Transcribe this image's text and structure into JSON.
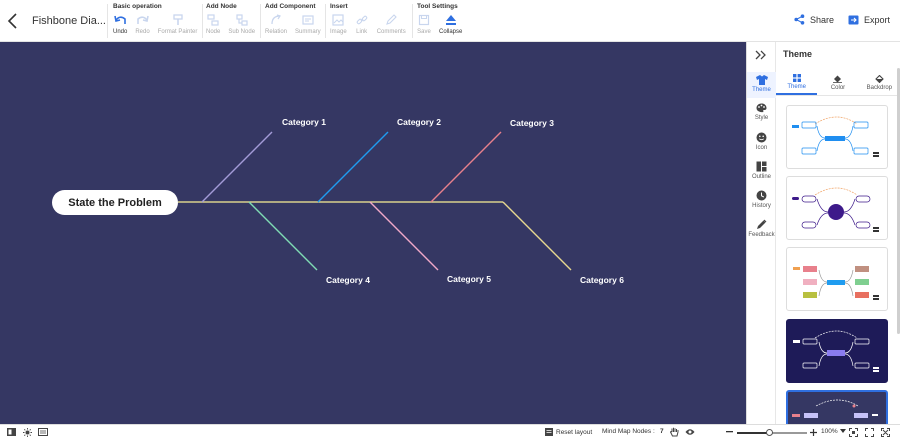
{
  "header": {
    "doc_title": "Fishbone Dia...",
    "groups": [
      {
        "label": "Basic operation",
        "tools": [
          {
            "label": "Undo",
            "icon": "undo-icon",
            "enabled": true
          },
          {
            "label": "Redo",
            "icon": "redo-icon",
            "enabled": false
          },
          {
            "label": "Format Painter",
            "icon": "format-painter-icon",
            "enabled": false
          }
        ]
      },
      {
        "label": "Add Node",
        "tools": [
          {
            "label": "Node",
            "icon": "node-icon",
            "enabled": false
          },
          {
            "label": "Sub Node",
            "icon": "sub-node-icon",
            "enabled": false
          }
        ]
      },
      {
        "label": "Add Component",
        "tools": [
          {
            "label": "Relation",
            "icon": "relation-icon",
            "enabled": false
          },
          {
            "label": "Summary",
            "icon": "summary-icon",
            "enabled": false
          }
        ]
      },
      {
        "label": "Insert",
        "tools": [
          {
            "label": "Image",
            "icon": "image-icon",
            "enabled": false
          },
          {
            "label": "Link",
            "icon": "link-icon",
            "enabled": false
          },
          {
            "label": "Comments",
            "icon": "comments-icon",
            "enabled": false
          }
        ]
      },
      {
        "label": "Tool Settings",
        "tools": [
          {
            "label": "Save",
            "icon": "save-icon",
            "enabled": false
          },
          {
            "label": "Collapse",
            "icon": "collapse-icon",
            "enabled": true
          }
        ]
      }
    ],
    "share_label": "Share",
    "export_label": "Export"
  },
  "canvas": {
    "head": "State the Problem",
    "categories": [
      "Category 1",
      "Category 2",
      "Category 3",
      "Category 4",
      "Category 5",
      "Category 6"
    ],
    "colors": {
      "background": "#353763",
      "spine": "#d9d08c",
      "bones": [
        "#a39bd8",
        "#1f9cf0",
        "#e8808c",
        "#7fdcb4",
        "#f0a8c8",
        "#e8d890"
      ]
    }
  },
  "rail": {
    "items": [
      {
        "label": "Theme",
        "icon": "shirt-icon",
        "active": true
      },
      {
        "label": "Style",
        "icon": "palette-icon",
        "active": false
      },
      {
        "label": "Icon",
        "icon": "smiley-icon",
        "active": false
      },
      {
        "label": "Outline",
        "icon": "outline-icon",
        "active": false
      },
      {
        "label": "History",
        "icon": "clock-icon",
        "active": false
      },
      {
        "label": "Feedback",
        "icon": "feedback-icon",
        "active": false
      }
    ]
  },
  "panel": {
    "title": "Theme",
    "tabs": [
      {
        "label": "Theme",
        "icon": "grid-icon",
        "active": true
      },
      {
        "label": "Color",
        "icon": "bucket-icon",
        "active": false
      },
      {
        "label": "Backdrop",
        "icon": "fill-icon",
        "active": false
      }
    ]
  },
  "statusbar": {
    "reset_label": "Reset layout",
    "nodes_label": "Mind Map Nodes :",
    "nodes_count": "7",
    "zoom": "100%",
    "zoom_level": 0.45
  },
  "accent": "#2f6fe0"
}
